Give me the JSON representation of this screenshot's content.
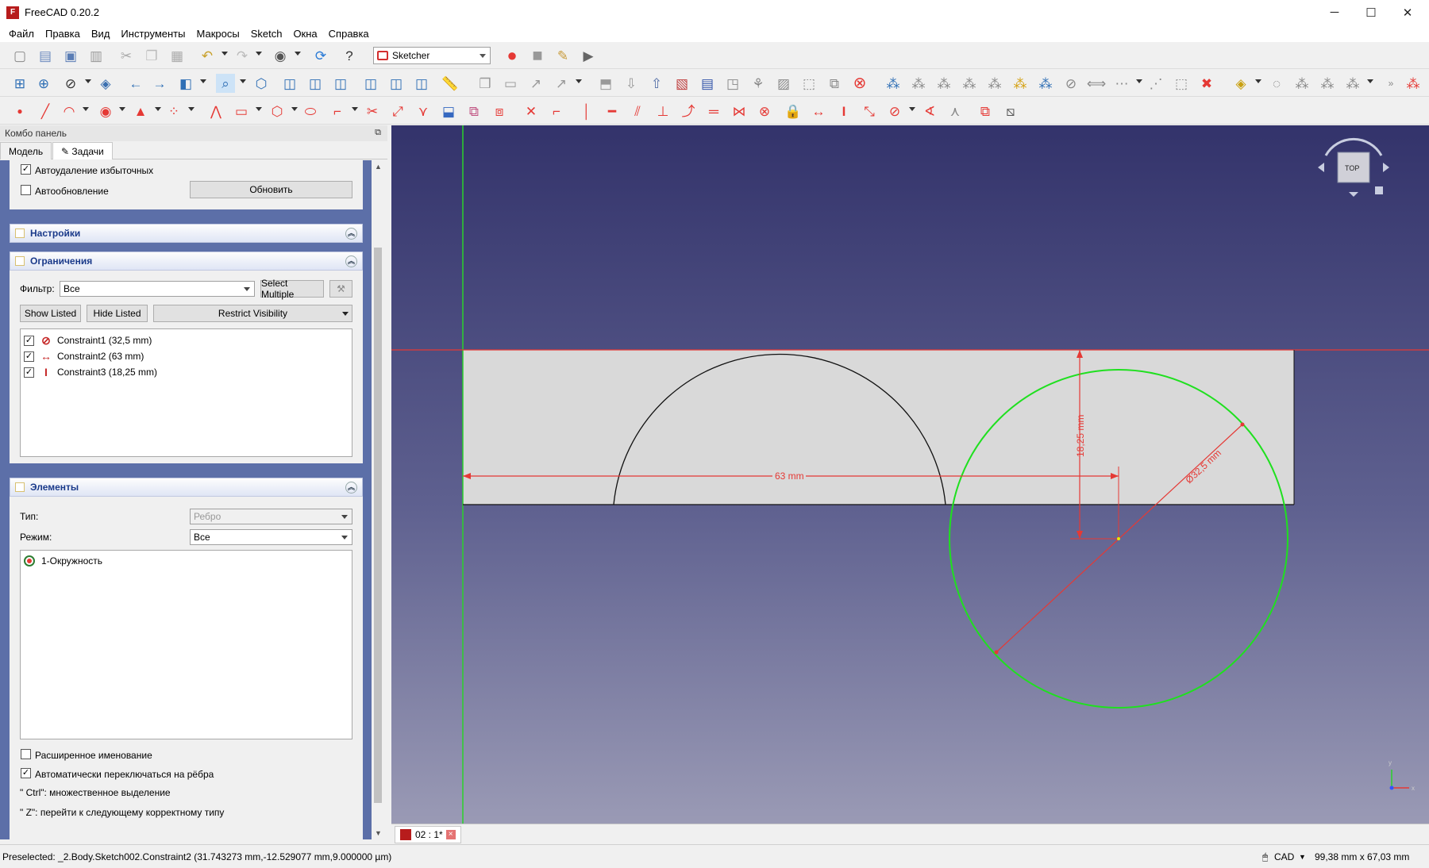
{
  "window": {
    "app_title": "FreeCAD 0.20.2",
    "minimize": "─",
    "maximize": "☐",
    "close": "✕"
  },
  "menu": [
    "Файл",
    "Правка",
    "Вид",
    "Инструменты",
    "Макросы",
    "Sketch",
    "Окна",
    "Справка"
  ],
  "toolbar": {
    "workbench": "Sketcher"
  },
  "combo_panel": {
    "title": "Комбо панель",
    "tabs": [
      "Модель",
      "Задачи"
    ],
    "top": {
      "auto_remove_label": "Автоудаление избыточных",
      "auto_update_label": "Автообновление",
      "update_button": "Обновить"
    },
    "settings": {
      "title": "Настройки"
    },
    "constraints": {
      "title": "Ограничения",
      "filter_label": "Фильтр:",
      "filter_value": "Все",
      "select_multiple": "Select Multiple",
      "show_listed": "Show Listed",
      "hide_listed": "Hide Listed",
      "restrict_visibility": "Restrict Visibility",
      "items": [
        {
          "label": "Constraint1 (32,5 mm)",
          "icon": "diameter-icon",
          "glyph": "⊘",
          "checked": true
        },
        {
          "label": "Constraint2 (63 mm)",
          "icon": "horizontal-distance-icon",
          "glyph": "↔",
          "checked": true
        },
        {
          "label": "Constraint3 (18,25 mm)",
          "icon": "vertical-distance-icon",
          "glyph": "I",
          "checked": true
        }
      ]
    },
    "elements": {
      "title": "Элементы",
      "type_label": "Тип:",
      "type_value": "Ребро",
      "mode_label": "Режим:",
      "mode_value": "Все",
      "items": [
        {
          "label": "1-Окружность",
          "icon": "circle-icon"
        }
      ],
      "extended_naming": "Расширенное именование",
      "auto_switch": "Автоматически переключаться на рёбра",
      "hint_ctrl": "\" Ctrl\": множественное выделение",
      "hint_z": "\" Z\": перейти к следующему корректному типу"
    }
  },
  "viewport": {
    "dim_horizontal": "63 mm",
    "dim_vertical": "18,25 mm",
    "dim_diameter": "Ø32,5 mm",
    "navcube_face": "TOP",
    "colors": {
      "sketch_fill": "#d9d9d9",
      "circle": "#1fe01f",
      "constraint": "#e53935",
      "edge": "#000000"
    }
  },
  "doc_tab": {
    "label": "02 : 1*"
  },
  "status": {
    "preselected": "Preselected: _2.Body.Sketch002.Constraint2 (31.743273 mm,-12.529077 mm,9.000000 µm)",
    "nav_style": "CAD",
    "dimensions": "99,38 mm x 67,03 mm"
  }
}
